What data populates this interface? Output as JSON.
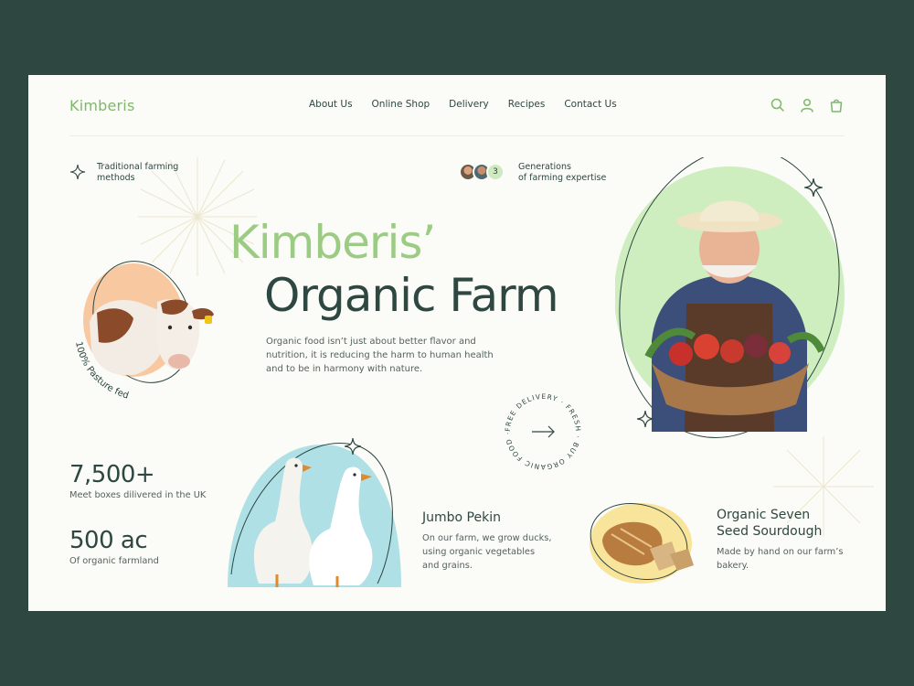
{
  "brand": {
    "name": "Kimberis"
  },
  "nav": [
    "About Us",
    "Online Shop",
    "Delivery",
    "Recipes",
    "Contact Us"
  ],
  "header_icons": [
    "search-icon",
    "user-icon",
    "shopping-bag-icon"
  ],
  "feature_left": {
    "line1": "Traditional farming",
    "line2": "methods"
  },
  "feature_right": {
    "count": "3",
    "line1": "Generations",
    "line2": "of farming expertise"
  },
  "hero": {
    "title_line1": "Kimberis’",
    "title_line2": "Organic Farm",
    "description": "Organic food isn’t just about better flavor and nutrition, it is reducing the harm to human health and to be in harmony with nature."
  },
  "cow_caption": "100% Pasture fed",
  "circle_badge": {
    "text": "FREE DELIVERY · FRESH · BUY ORGANIC FOOD ·"
  },
  "stats": [
    {
      "value": "7,500+",
      "label": "Meet boxes dilivered in the UK"
    },
    {
      "value": "500 ac",
      "label": "Of organic farmland"
    }
  ],
  "products": [
    {
      "title": "Jumbo Pekin",
      "description_lines": [
        "On our farm, we grow ducks,",
        "using organic vegetables",
        "and grains."
      ]
    },
    {
      "title_lines": [
        "Organic Seven",
        "Seed Sourdough"
      ],
      "description_lines": [
        "Made by hand on our farm’s",
        "bakery."
      ]
    }
  ],
  "colors": {
    "background": "#2f4741",
    "page": "#fbfbf7",
    "green_accent": "#9ccc84",
    "dark_green": "#2f4741",
    "peach": "#f8c9a0",
    "sky": "#aee0e6",
    "mint": "#cfe9c0",
    "yellow": "#f8e49a"
  }
}
